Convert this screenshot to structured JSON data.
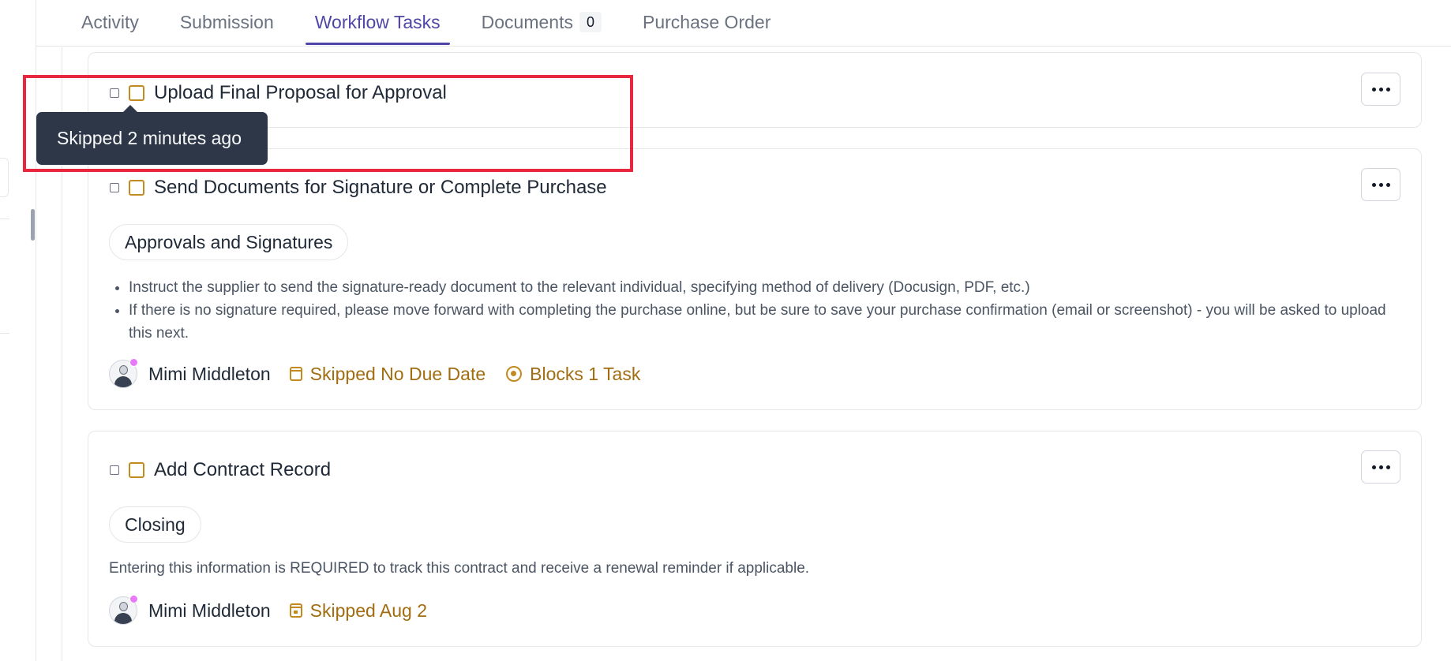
{
  "tabs": [
    {
      "label": "Activity",
      "active": false
    },
    {
      "label": "Submission",
      "active": false
    },
    {
      "label": "Workflow Tasks",
      "active": true
    },
    {
      "label": "Documents",
      "active": false,
      "badge": "0"
    },
    {
      "label": "Purchase Order",
      "active": false
    }
  ],
  "tooltip": {
    "text": "Skipped 2 minutes ago"
  },
  "tasks": [
    {
      "title": "Upload Final Proposal for Approval"
    },
    {
      "title": "Send Documents for Signature or Complete Purchase",
      "stage": "Approvals and Signatures",
      "bullets": [
        "Instruct the supplier to send the signature-ready document to the relevant individual, specifying method of delivery (Docusign, PDF, etc.)",
        "If there is no signature required, please move forward with completing the purchase online, but be sure to save your purchase confirmation (email or screenshot) - you will be asked to upload this next."
      ],
      "assignee": "Mimi Middleton",
      "due": "Skipped No Due Date",
      "blocks": "Blocks 1 Task"
    },
    {
      "title": "Add Contract Record",
      "stage": "Closing",
      "description": "Entering this information is REQUIRED to track this contract and receive a renewal reminder if applicable.",
      "assignee": "Mimi Middleton",
      "due": "Skipped Aug 2"
    }
  ],
  "colors": {
    "accent": "#4f46a8",
    "status_gold": "#a16d10",
    "highlight": "#e8273f",
    "tooltip_bg": "#2d3748"
  }
}
